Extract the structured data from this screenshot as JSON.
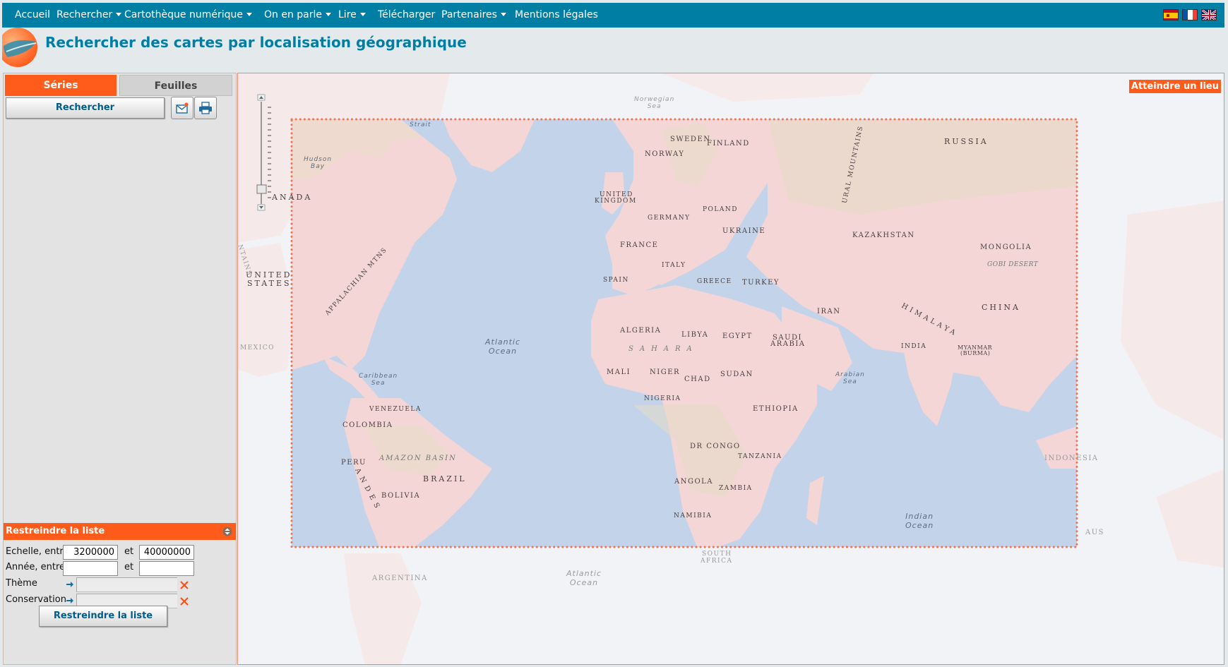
{
  "nav": {
    "items": [
      {
        "label": "Accueil",
        "dropdown": false
      },
      {
        "label": "Rechercher",
        "dropdown": true
      },
      {
        "label": "Cartothèque numérique",
        "dropdown": true
      },
      {
        "label": "On en parle",
        "dropdown": true
      },
      {
        "label": "Lire",
        "dropdown": true
      },
      {
        "label": "Télécharger",
        "dropdown": false
      },
      {
        "label": "Partenaires",
        "dropdown": true
      },
      {
        "label": "Mentions légales",
        "dropdown": false
      }
    ],
    "flags": [
      "spain-flag-icon",
      "france-flag-icon",
      "uk-flag-icon"
    ]
  },
  "header": {
    "title": "Rechercher des cartes par localisation géographique"
  },
  "left": {
    "tabs": {
      "series": "Séries",
      "feuilles": "Feuilles"
    },
    "search_button": "Rechercher",
    "email_icon": "email-icon",
    "print_icon": "print-icon",
    "restrict": {
      "header": "Restreindre la liste",
      "echelle_label": "Echelle, entre",
      "echelle_min": "3200000",
      "echelle_and": "et",
      "echelle_max": "40000000",
      "annee_label": "Année, entre",
      "annee_min": "",
      "annee_and": "et",
      "annee_max": "",
      "theme_label": "Thème",
      "conservation_label": "Conservation",
      "button": "Restreindre la liste"
    }
  },
  "map": {
    "goto_button": "Atteindre un lieu",
    "colors": {
      "ocean": "#c3d3ea",
      "land": "#f4d6d6",
      "outside": "#f1f3f6",
      "selection": "#f07352",
      "accent": "#ff5b1a",
      "nav": "#007ea3"
    },
    "labels": {
      "sweden": "SWEDEN",
      "finland": "FINLAND",
      "russia": "RUSSIA",
      "norway": "NORWAY",
      "united_kingdom_1": "UNITED",
      "united_kingdom_2": "KINGDOM",
      "germany": "GERMANY",
      "poland": "POLAND",
      "ukraine": "UKRAINE",
      "kazakhstan": "KAZAKHSTAN",
      "mongolia": "MONGOLIA",
      "gobi": "GOBI DESERT",
      "france": "FRANCE",
      "italy": "ITALY",
      "spain": "SPAIN",
      "greece": "GREECE",
      "turkey": "TURKEY",
      "iran": "IRAN",
      "china": "CHINA",
      "himalaya": "HIMALAYA",
      "algeria": "ALGERIA",
      "libya": "LIBYA",
      "egypt": "EGYPT",
      "saudi_1": "SAUDI",
      "saudi_2": "ARABIA",
      "india": "INDIA",
      "myanmar_1": "MYANMAR",
      "myanmar_2": "(BURMA)",
      "sahara": "SAHARA",
      "mali": "MALI",
      "niger": "NIGER",
      "chad": "CHAD",
      "sudan": "SUDAN",
      "nigeria": "NIGERIA",
      "ethiopia": "ETHIOPIA",
      "dr_congo": "DR CONGO",
      "tanzania": "TANZANIA",
      "angola": "ANGOLA",
      "zambia": "ZAMBIA",
      "namibia": "NAMIBIA",
      "south_africa_1": "SOUTH",
      "south_africa_2": "AFRICA",
      "indonesia": "INDONESIA",
      "aus": "AUS",
      "venezuela": "VENEZUELA",
      "colombia": "COLOMBIA",
      "peru": "PERU",
      "bolivia": "BOLIVIA",
      "brazil": "BRAZIL",
      "amazon": "AMAZON BASIN",
      "andes": "ANDES",
      "argentina": "ARGENTINA",
      "us_1": "UNITED",
      "us_2": "STATES",
      "canada": "ANADA",
      "mexico": "MEXICO",
      "appalachian": "APPALACHIAN MTNS",
      "ural": "URAL MOUNTAINS",
      "ntains": "NTAINS",
      "atlantic_1": "Atlantic",
      "atlantic_2": "Ocean",
      "atlantic_south_1": "Atlantic",
      "atlantic_south_2": "Ocean",
      "indian_1": "Indian",
      "indian_2": "Ocean",
      "caribbean_1": "Caribbean",
      "caribbean_2": "Sea",
      "arabian_1": "Arabian",
      "arabian_2": "Sea",
      "hudson_1": "Hudson",
      "hudson_2": "Bay",
      "norwegian_1": "Norwegian",
      "norwegian_2": "Sea",
      "strait": "Strait"
    }
  }
}
